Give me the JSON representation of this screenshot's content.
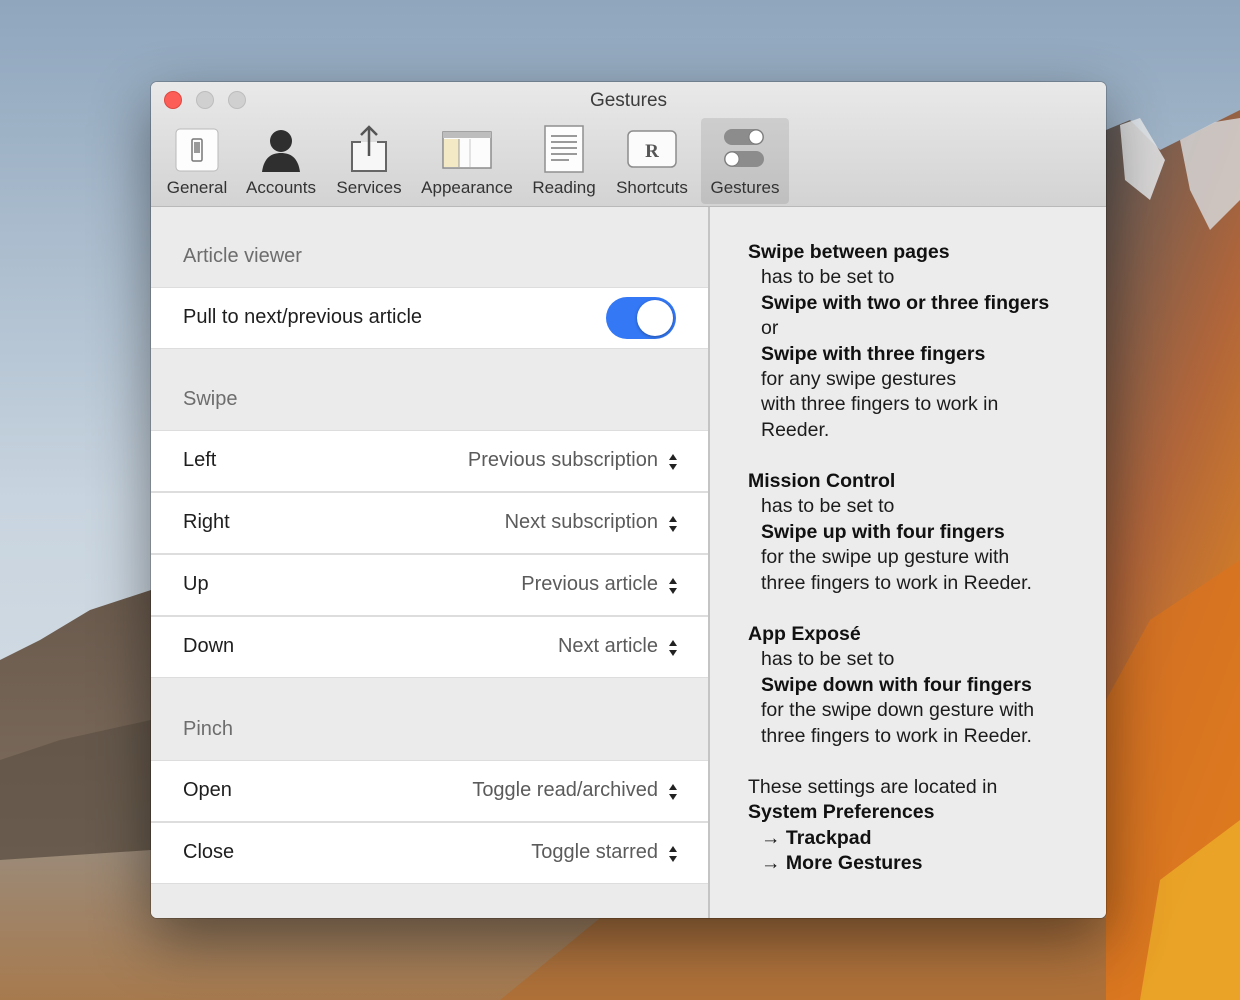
{
  "window": {
    "title": "Gestures"
  },
  "toolbar": {
    "items": [
      {
        "label": "General",
        "icon": "general-icon"
      },
      {
        "label": "Accounts",
        "icon": "accounts-icon"
      },
      {
        "label": "Services",
        "icon": "share-icon"
      },
      {
        "label": "Appearance",
        "icon": "appearance-icon"
      },
      {
        "label": "Reading",
        "icon": "reading-icon"
      },
      {
        "label": "Shortcuts",
        "icon": "shortcuts-icon",
        "glyph": "R"
      },
      {
        "label": "Gestures",
        "icon": "gestures-icon",
        "selected": true
      }
    ]
  },
  "settings": {
    "article_viewer": {
      "header": "Article viewer",
      "pull_label": "Pull to next/previous article",
      "pull_enabled": true
    },
    "swipe": {
      "header": "Swipe",
      "rows": [
        {
          "label": "Left",
          "value": "Previous subscription"
        },
        {
          "label": "Right",
          "value": "Next subscription"
        },
        {
          "label": "Up",
          "value": "Previous article"
        },
        {
          "label": "Down",
          "value": "Next article"
        }
      ]
    },
    "pinch": {
      "header": "Pinch",
      "rows": [
        {
          "label": "Open",
          "value": "Toggle read/archived"
        },
        {
          "label": "Close",
          "value": "Toggle starred"
        }
      ]
    }
  },
  "info": {
    "swipe_pages": {
      "title": "Swipe between pages",
      "l1": "has to be set to",
      "l2": "Swipe with two or three fingers",
      "l3": "or",
      "l4": "Swipe with three fingers",
      "l5": "for any swipe gestures",
      "l6": "with three fingers to work in",
      "l7": "Reeder."
    },
    "mission_control": {
      "title": "Mission Control",
      "l1": "has to be set to",
      "l2": "Swipe up with four fingers",
      "l3": "for the swipe up gesture with",
      "l4": "three fingers to work in Reeder."
    },
    "app_expose": {
      "title": "App Exposé",
      "l1": "has to be set to",
      "l2": "Swipe down with four fingers",
      "l3": "for the swipe down gesture with",
      "l4": "three fingers to work in Reeder."
    },
    "location": {
      "l1": "These settings are located in",
      "l2": "System Preferences",
      "l3": "→ Trackpad",
      "l4": "→ More Gestures"
    }
  },
  "colors": {
    "toggle_on": "#3478f6",
    "close_button": "#fc5d57"
  }
}
